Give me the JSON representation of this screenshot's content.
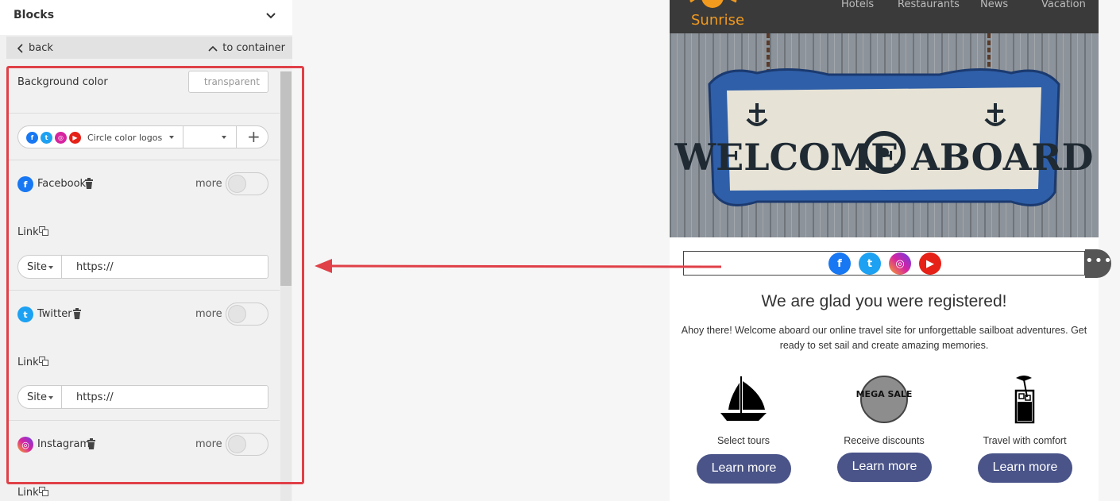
{
  "panel": {
    "title": "Blocks",
    "back_label": "back",
    "container_label": "to container"
  },
  "settings": {
    "bg_color_label": "Background color",
    "bg_color_value": "transparent",
    "logo_style": "Circle color logos",
    "more_label": "more",
    "link_label": "Link",
    "site_label": "Site",
    "url_placeholder": "https://",
    "networks": [
      {
        "name": "Facebook",
        "color": "#1877f2",
        "icon": "facebook-icon"
      },
      {
        "name": "Twitter",
        "color": "#1da1f2",
        "icon": "twitter-icon"
      },
      {
        "name": "Instagram",
        "color": "#d6249f",
        "icon": "instagram-icon"
      }
    ]
  },
  "preview": {
    "brand": "Sunrise",
    "nav": [
      "Hotels",
      "Restaurants",
      "News",
      "Vacation"
    ],
    "hero_text": "WELCOME ABOARD",
    "heading": "We are glad you were registered!",
    "paragraph": "Ahoy there! Welcome aboard our online travel site for unforgettable sailboat adventures. Get ready to set sail and create amazing memories.",
    "mega_sale": "MEGA SALE",
    "features": [
      {
        "caption": "Select tours",
        "button": "Learn more",
        "icon": "sailboat-icon"
      },
      {
        "caption": "Receive discounts",
        "button": "Learn more",
        "icon": "mega-sale-icon"
      },
      {
        "caption": "Travel with comfort",
        "button": "Learn more",
        "icon": "cocktail-icon"
      }
    ]
  },
  "colors": {
    "accent_red": "#e04048",
    "button_blue": "#4a5488",
    "facebook": "#1877f2",
    "twitter": "#1da1f2",
    "instagram": "#d6249f",
    "youtube": "#e62117"
  }
}
